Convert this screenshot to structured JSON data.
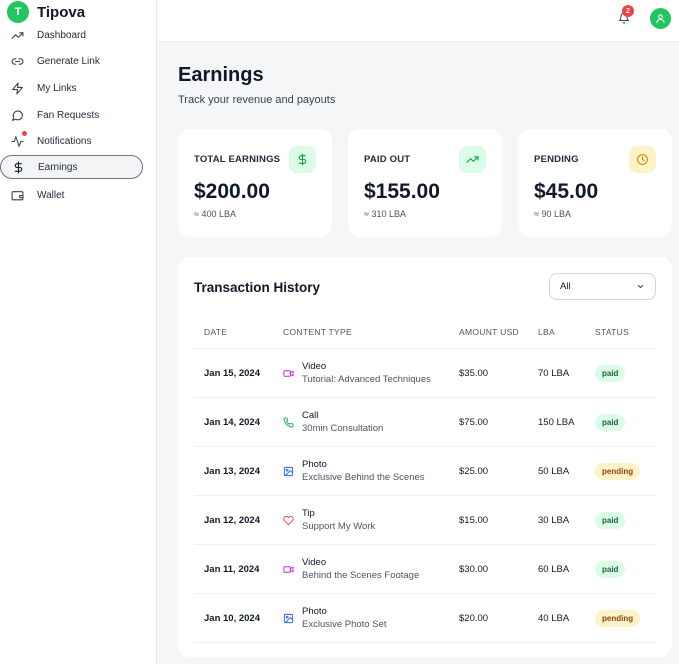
{
  "brand": {
    "initial": "T",
    "name": "Tipova"
  },
  "nav": [
    {
      "label": "Dashboard",
      "icon": "trending-up-icon"
    },
    {
      "label": "Generate Link",
      "icon": "link-icon"
    },
    {
      "label": "My Links",
      "icon": "zap-icon"
    },
    {
      "label": "Fan Requests",
      "icon": "message-circle-icon"
    },
    {
      "label": "Notifications",
      "icon": "activity-icon"
    },
    {
      "label": "Earnings",
      "icon": "dollar-icon",
      "active": true
    },
    {
      "label": "Wallet",
      "icon": "wallet-icon"
    }
  ],
  "topbar": {
    "notification_count": "2"
  },
  "page": {
    "title": "Earnings",
    "subtitle": "Track your revenue and payouts"
  },
  "stats": [
    {
      "label": "TOTAL EARNINGS",
      "value": "$200.00",
      "sub": "≈ 400 LBA",
      "icon": "dollar-icon",
      "icon_bg": "#dcfce7",
      "icon_color": "#16a34a"
    },
    {
      "label": "PAID OUT",
      "value": "$155.00",
      "sub": "≈ 310 LBA",
      "icon": "trending-up-icon",
      "icon_bg": "#dcfce7",
      "icon_color": "#16a34a"
    },
    {
      "label": "PENDING",
      "value": "$45.00",
      "sub": "≈ 90 LBA",
      "icon": "clock-icon",
      "icon_bg": "#fef3c7",
      "icon_color": "#ca8a04"
    }
  ],
  "transactions": {
    "title": "Transaction History",
    "filter": "All",
    "columns": [
      "DATE",
      "CONTENT TYPE",
      "AMOUNT USD",
      "LBA",
      "STATUS"
    ],
    "rows": [
      {
        "date": "Jan 15, 2024",
        "type": "Video",
        "desc": "Tutorial: Advanced Techniques",
        "amount": "$35.00",
        "lba": "70 LBA",
        "status": "paid",
        "icon": "video-icon"
      },
      {
        "date": "Jan 14, 2024",
        "type": "Call",
        "desc": "30min Consultation",
        "amount": "$75.00",
        "lba": "150 LBA",
        "status": "paid",
        "icon": "phone-icon"
      },
      {
        "date": "Jan 13, 2024",
        "type": "Photo",
        "desc": "Exclusive Behind the Scenes",
        "amount": "$25.00",
        "lba": "50 LBA",
        "status": "pending",
        "icon": "image-icon"
      },
      {
        "date": "Jan 12, 2024",
        "type": "Tip",
        "desc": "Support My Work",
        "amount": "$15.00",
        "lba": "30 LBA",
        "status": "paid",
        "icon": "heart-icon"
      },
      {
        "date": "Jan 11, 2024",
        "type": "Video",
        "desc": "Behind the Scenes Footage",
        "amount": "$30.00",
        "lba": "60 LBA",
        "status": "paid",
        "icon": "video-icon"
      },
      {
        "date": "Jan 10, 2024",
        "type": "Photo",
        "desc": "Exclusive Photo Set",
        "amount": "$20.00",
        "lba": "40 LBA",
        "status": "pending",
        "icon": "image-icon"
      }
    ]
  },
  "colors": {
    "accent": "#22c55e",
    "paid_bg": "#dcfce7",
    "pending_bg": "#fef3c7",
    "notification": "#ef4444"
  }
}
